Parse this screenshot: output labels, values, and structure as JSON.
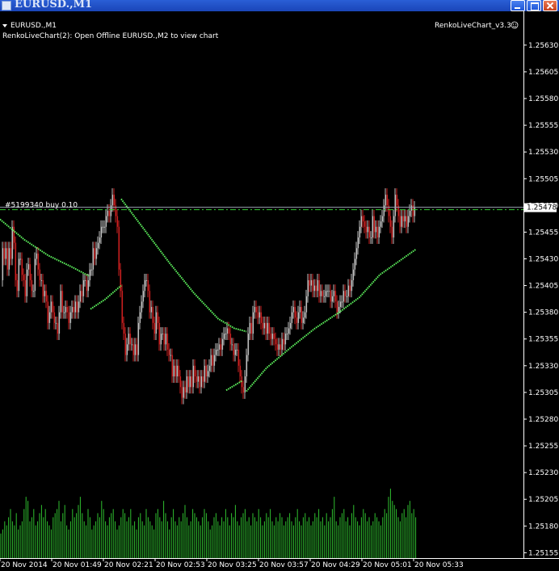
{
  "window": {
    "title": "EURUSD.,M1"
  },
  "chart": {
    "symbol_label": "EURUSD.,M1",
    "info_line": "RenkoLiveChart(2): Open Offline EURUSD.,M2 to view chart",
    "indicator_label": "RenkoLiveChart_v3.3",
    "order_label": "#5199340 buy 0.10",
    "current_price": "1.25478",
    "colors": {
      "background": "#000000",
      "up_bar": "#c0c0c0",
      "down_bar": "#cc1f1f",
      "moving_average": "#5cf05c",
      "volume": "#2fbf2f",
      "order_line": "#33cc33",
      "bid_line": "#9aa0b0"
    },
    "icons": [
      "window-app-icon",
      "minimize-icon",
      "maximize-icon",
      "close-icon",
      "smiley-icon",
      "dropdown-triangle-icon"
    ]
  },
  "chart_data": {
    "type": "candlestick",
    "y_ticks": [
      "1.25630",
      "1.25605",
      "1.25580",
      "1.25555",
      "1.25530",
      "1.25505",
      "1.25480",
      "1.25455",
      "1.25430",
      "1.25405",
      "1.25380",
      "1.25355",
      "1.25330",
      "1.25305",
      "1.25280",
      "1.25255",
      "1.25230",
      "1.25205",
      "1.25180",
      "1.25155"
    ],
    "x_ticks": [
      "20 Nov 2014",
      "20 Nov 01:49",
      "20 Nov 02:21",
      "20 Nov 02:53",
      "20 Nov 03:25",
      "20 Nov 03:57",
      "20 Nov 04:29",
      "20 Nov 05:01",
      "20 Nov 05:33"
    ],
    "ylim": [
      1.2515,
      1.25645
    ],
    "order_price": 1.25476,
    "price_series": [
      [
        0,
        1.2541
      ],
      [
        2,
        1.2544
      ],
      [
        4,
        1.2543
      ],
      [
        6,
        1.2544
      ],
      [
        8,
        1.2542
      ],
      [
        10,
        1.2544
      ],
      [
        12,
        1.2543
      ],
      [
        14,
        1.2546
      ],
      [
        16,
        1.25445
      ],
      [
        18,
        1.2541
      ],
      [
        20,
        1.254
      ],
      [
        22,
        1.2543
      ],
      [
        24,
        1.2543
      ],
      [
        26,
        1.25415
      ],
      [
        28,
        1.2541
      ],
      [
        30,
        1.25395
      ],
      [
        32,
        1.2542
      ],
      [
        34,
        1.25425
      ],
      [
        36,
        1.2541
      ],
      [
        38,
        1.254
      ],
      [
        40,
        1.254
      ],
      [
        42,
        1.2543
      ],
      [
        44,
        1.25435
      ],
      [
        46,
        1.2542
      ],
      [
        48,
        1.2541
      ],
      [
        50,
        1.2541
      ],
      [
        52,
        1.25395
      ],
      [
        54,
        1.254
      ],
      [
        56,
        1.2539
      ],
      [
        58,
        1.2537
      ],
      [
        60,
        1.2538
      ],
      [
        62,
        1.2539
      ],
      [
        64,
        1.2538
      ],
      [
        66,
        1.2537
      ],
      [
        68,
        1.2537
      ],
      [
        70,
        1.2536
      ],
      [
        72,
        1.2538
      ],
      [
        74,
        1.254
      ],
      [
        76,
        1.2538
      ],
      [
        78,
        1.2538
      ],
      [
        80,
        1.25385
      ],
      [
        82,
        1.2538
      ],
      [
        84,
        1.2537
      ],
      [
        86,
        1.2538
      ],
      [
        88,
        1.25385
      ],
      [
        90,
        1.2538
      ],
      [
        92,
        1.2539
      ],
      [
        94,
        1.2538
      ],
      [
        96,
        1.2539
      ],
      [
        98,
        1.254
      ],
      [
        100,
        1.25395
      ],
      [
        102,
        1.2541
      ],
      [
        104,
        1.2541
      ],
      [
        106,
        1.254
      ],
      [
        108,
        1.2541
      ],
      [
        110,
        1.2542
      ],
      [
        112,
        1.2542
      ],
      [
        114,
        1.2544
      ],
      [
        116,
        1.2543
      ],
      [
        118,
        1.2544
      ],
      [
        120,
        1.25445
      ],
      [
        122,
        1.2545
      ],
      [
        124,
        1.2546
      ],
      [
        126,
        1.2546
      ],
      [
        128,
        1.2546
      ],
      [
        130,
        1.2547
      ],
      [
        132,
        1.25475
      ],
      [
        134,
        1.2547
      ],
      [
        136,
        1.2548
      ],
      [
        138,
        1.2549
      ],
      [
        140,
        1.2548
      ],
      [
        142,
        1.2547
      ],
      [
        144,
        1.2546
      ],
      [
        146,
        1.2542
      ],
      [
        148,
        1.254
      ],
      [
        150,
        1.2537
      ],
      [
        152,
        1.2536
      ],
      [
        154,
        1.2534
      ],
      [
        156,
        1.2535
      ],
      [
        158,
        1.2536
      ],
      [
        160,
        1.2535
      ],
      [
        162,
        1.2535
      ],
      [
        164,
        1.2534
      ],
      [
        166,
        1.2535
      ],
      [
        168,
        1.2534
      ],
      [
        170,
        1.2537
      ],
      [
        172,
        1.2538
      ],
      [
        174,
        1.2539
      ],
      [
        176,
        1.254
      ],
      [
        178,
        1.2541
      ],
      [
        180,
        1.2541
      ],
      [
        182,
        1.254
      ],
      [
        184,
        1.2538
      ],
      [
        186,
        1.25385
      ],
      [
        188,
        1.2537
      ],
      [
        190,
        1.2536
      ],
      [
        192,
        1.2538
      ],
      [
        194,
        1.2537
      ],
      [
        196,
        1.2535
      ],
      [
        198,
        1.2536
      ],
      [
        200,
        1.2536
      ],
      [
        202,
        1.2535
      ],
      [
        204,
        1.2536
      ],
      [
        206,
        1.25345
      ],
      [
        208,
        1.2534
      ],
      [
        210,
        1.2534
      ],
      [
        212,
        1.2532
      ],
      [
        214,
        1.2533
      ],
      [
        216,
        1.2532
      ],
      [
        218,
        1.2533
      ],
      [
        220,
        1.2532
      ],
      [
        222,
        1.2531
      ],
      [
        224,
        1.253
      ],
      [
        226,
        1.2531
      ],
      [
        228,
        1.25305
      ],
      [
        230,
        1.2532
      ],
      [
        232,
        1.2531
      ],
      [
        234,
        1.2532
      ],
      [
        236,
        1.2531
      ],
      [
        238,
        1.2533
      ],
      [
        240,
        1.2532
      ],
      [
        242,
        1.25315
      ],
      [
        244,
        1.2532
      ],
      [
        246,
        1.2531
      ],
      [
        248,
        1.2532
      ],
      [
        250,
        1.25315
      ],
      [
        252,
        1.2533
      ],
      [
        254,
        1.2532
      ],
      [
        256,
        1.25325
      ],
      [
        258,
        1.2533
      ],
      [
        260,
        1.2534
      ],
      [
        262,
        1.2533
      ],
      [
        264,
        1.2534
      ],
      [
        266,
        1.25345
      ],
      [
        268,
        1.25345
      ],
      [
        270,
        1.2535
      ],
      [
        272,
        1.25345
      ],
      [
        274,
        1.25355
      ],
      [
        276,
        1.2536
      ],
      [
        278,
        1.2536
      ],
      [
        280,
        1.25365
      ],
      [
        282,
        1.2536
      ],
      [
        284,
        1.2535
      ],
      [
        286,
        1.2535
      ],
      [
        288,
        1.2534
      ],
      [
        290,
        1.25345
      ],
      [
        292,
        1.25345
      ],
      [
        294,
        1.2533
      ],
      [
        296,
        1.2532
      ],
      [
        298,
        1.2531
      ],
      [
        300,
        1.25305
      ],
      [
        302,
        1.2532
      ],
      [
        304,
        1.2534
      ],
      [
        306,
        1.2536
      ],
      [
        308,
        1.2537
      ],
      [
        310,
        1.2536
      ],
      [
        312,
        1.2538
      ],
      [
        314,
        1.25385
      ],
      [
        316,
        1.2538
      ],
      [
        318,
        1.25375
      ],
      [
        320,
        1.2538
      ],
      [
        322,
        1.2537
      ],
      [
        324,
        1.25365
      ],
      [
        326,
        1.2537
      ],
      [
        328,
        1.2536
      ],
      [
        330,
        1.2537
      ],
      [
        332,
        1.2536
      ],
      [
        334,
        1.25355
      ],
      [
        336,
        1.2536
      ],
      [
        338,
        1.25355
      ],
      [
        340,
        1.2535
      ],
      [
        342,
        1.25345
      ],
      [
        344,
        1.2535
      ],
      [
        346,
        1.25345
      ],
      [
        348,
        1.25355
      ],
      [
        350,
        1.2535
      ],
      [
        352,
        1.2536
      ],
      [
        354,
        1.2536
      ],
      [
        356,
        1.25365
      ],
      [
        358,
        1.2537
      ],
      [
        360,
        1.2538
      ],
      [
        362,
        1.25385
      ],
      [
        364,
        1.25375
      ],
      [
        366,
        1.2537
      ],
      [
        368,
        1.2538
      ],
      [
        370,
        1.25385
      ],
      [
        372,
        1.2537
      ],
      [
        374,
        1.25375
      ],
      [
        376,
        1.2538
      ],
      [
        378,
        1.25395
      ],
      [
        380,
        1.2541
      ],
      [
        382,
        1.25405
      ],
      [
        384,
        1.2541
      ],
      [
        386,
        1.254
      ],
      [
        388,
        1.25405
      ],
      [
        390,
        1.254
      ],
      [
        392,
        1.2541
      ],
      [
        394,
        1.25395
      ],
      [
        396,
        1.254
      ],
      [
        398,
        1.25395
      ],
      [
        400,
        1.25395
      ],
      [
        402,
        1.254
      ],
      [
        404,
        1.254
      ],
      [
        406,
        1.254
      ],
      [
        408,
        1.2539
      ],
      [
        410,
        1.25395
      ],
      [
        412,
        1.254
      ],
      [
        414,
        1.2539
      ],
      [
        416,
        1.2538
      ],
      [
        418,
        1.25385
      ],
      [
        420,
        1.2539
      ],
      [
        422,
        1.2539
      ],
      [
        424,
        1.254
      ],
      [
        426,
        1.25395
      ],
      [
        428,
        1.25395
      ],
      [
        430,
        1.25405
      ],
      [
        432,
        1.254
      ],
      [
        434,
        1.2541
      ],
      [
        436,
        1.2542
      ],
      [
        438,
        1.2543
      ],
      [
        440,
        1.2544
      ],
      [
        442,
        1.2545
      ],
      [
        444,
        1.2546
      ],
      [
        446,
        1.2547
      ],
      [
        448,
        1.25465
      ],
      [
        450,
        1.2546
      ],
      [
        452,
        1.25455
      ],
      [
        454,
        1.2546
      ],
      [
        456,
        1.2545
      ],
      [
        458,
        1.2545
      ],
      [
        460,
        1.2547
      ],
      [
        462,
        1.25455
      ],
      [
        464,
        1.2546
      ],
      [
        466,
        1.2545
      ],
      [
        468,
        1.2546
      ],
      [
        470,
        1.25465
      ],
      [
        472,
        1.2547
      ],
      [
        474,
        1.2548
      ],
      [
        476,
        1.2549
      ],
      [
        478,
        1.2548
      ],
      [
        480,
        1.2547
      ],
      [
        482,
        1.2546
      ],
      [
        484,
        1.2545
      ],
      [
        486,
        1.2547
      ],
      [
        488,
        1.2549
      ],
      [
        490,
        1.2548
      ],
      [
        492,
        1.2547
      ],
      [
        494,
        1.2546
      ],
      [
        496,
        1.2547
      ],
      [
        498,
        1.25465
      ],
      [
        500,
        1.2547
      ],
      [
        502,
        1.2546
      ],
      [
        504,
        1.2547
      ],
      [
        506,
        1.25475
      ],
      [
        508,
        1.2548
      ],
      [
        510,
        1.2547
      ],
      [
        512,
        1.25478
      ]
    ],
    "ma_segments": [
      [
        [
          0,
          1.25467
        ],
        [
          30,
          1.25448
        ],
        [
          60,
          1.25433
        ],
        [
          90,
          1.25422
        ],
        [
          110,
          1.25414
        ]
      ],
      [
        [
          112,
          1.25383
        ],
        [
          130,
          1.25392
        ],
        [
          150,
          1.25405
        ]
      ],
      [
        [
          150,
          1.25486
        ],
        [
          180,
          1.25456
        ],
        [
          210,
          1.25426
        ],
        [
          240,
          1.25398
        ],
        [
          270,
          1.25374
        ],
        [
          290,
          1.25365
        ],
        [
          305,
          1.25362
        ]
      ],
      [
        [
          280,
          1.25307
        ],
        [
          300,
          1.25316
        ]
      ],
      [
        [
          305,
          1.25306
        ],
        [
          330,
          1.25328
        ],
        [
          360,
          1.25347
        ],
        [
          390,
          1.25365
        ],
        [
          420,
          1.2538
        ],
        [
          445,
          1.25394
        ],
        [
          470,
          1.25415
        ],
        [
          500,
          1.25431
        ],
        [
          515,
          1.25439
        ]
      ]
    ],
    "volume": [
      6,
      7,
      9,
      8,
      10,
      12,
      9,
      8,
      11,
      7,
      8,
      9,
      12,
      15,
      14,
      9,
      10,
      12,
      8,
      9,
      11,
      13,
      10,
      12,
      9,
      8,
      7,
      10,
      11,
      12,
      14,
      9,
      11,
      13,
      8,
      7,
      9,
      12,
      10,
      11,
      13,
      15,
      11,
      9,
      8,
      12,
      10,
      7,
      8,
      9,
      11,
      10,
      14,
      12,
      9,
      8,
      10,
      11,
      12,
      9,
      7,
      8,
      10,
      12,
      11,
      9,
      10,
      12,
      8,
      9,
      7,
      10,
      11,
      9,
      8,
      12,
      10,
      9,
      8,
      7,
      11,
      12,
      10,
      9,
      14,
      11,
      9,
      7,
      10,
      12,
      9,
      8,
      10,
      9,
      11,
      13,
      10,
      8,
      9,
      12,
      11,
      10,
      9,
      8,
      10,
      12,
      11,
      9,
      7,
      8,
      10,
      11,
      9,
      8,
      10,
      9,
      12,
      10,
      8,
      11,
      10,
      13,
      9,
      8,
      10,
      11,
      12,
      9,
      10,
      8,
      11,
      10,
      9,
      12,
      10,
      8,
      9,
      11,
      10,
      12,
      9,
      8,
      10,
      9,
      11,
      10,
      8,
      9,
      10,
      11,
      9,
      8,
      10,
      12,
      9,
      8,
      10,
      11,
      9,
      10,
      8,
      9,
      11,
      10,
      12,
      9,
      10,
      8,
      11,
      9,
      10,
      12,
      15,
      9,
      8,
      10,
      11,
      12,
      9,
      10,
      8,
      11,
      13,
      10,
      9,
      8,
      10,
      12,
      11,
      9,
      10,
      8,
      9,
      11,
      10,
      9,
      8,
      10,
      12,
      11,
      15,
      17,
      14,
      13,
      12,
      10,
      9,
      11,
      12,
      10,
      13,
      14,
      11,
      12,
      10,
      9,
      8
    ]
  }
}
